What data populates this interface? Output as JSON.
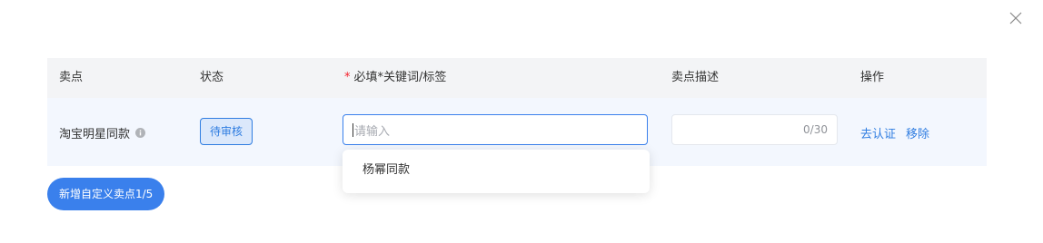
{
  "table": {
    "headers": {
      "point": "卖点",
      "status": "状态",
      "keyword_star": "*",
      "keyword": "必填*关键词/标签",
      "description": "卖点描述",
      "actions": "操作"
    },
    "rows": [
      {
        "point": "淘宝明星同款",
        "status": "待审核",
        "keyword_placeholder": "请输入",
        "description_count": "0/30",
        "action_certify": "去认证",
        "action_remove": "移除"
      }
    ]
  },
  "dropdown": {
    "options": [
      "杨幂同款"
    ]
  },
  "footer": {
    "add_button_label": "新增自定义卖点1/5"
  },
  "colors": {
    "primary": "#3a80ec",
    "link": "#2f7de1",
    "required": "#f5222d",
    "header_bg": "#f3f4f6",
    "row_bg": "#f3f7fe"
  }
}
